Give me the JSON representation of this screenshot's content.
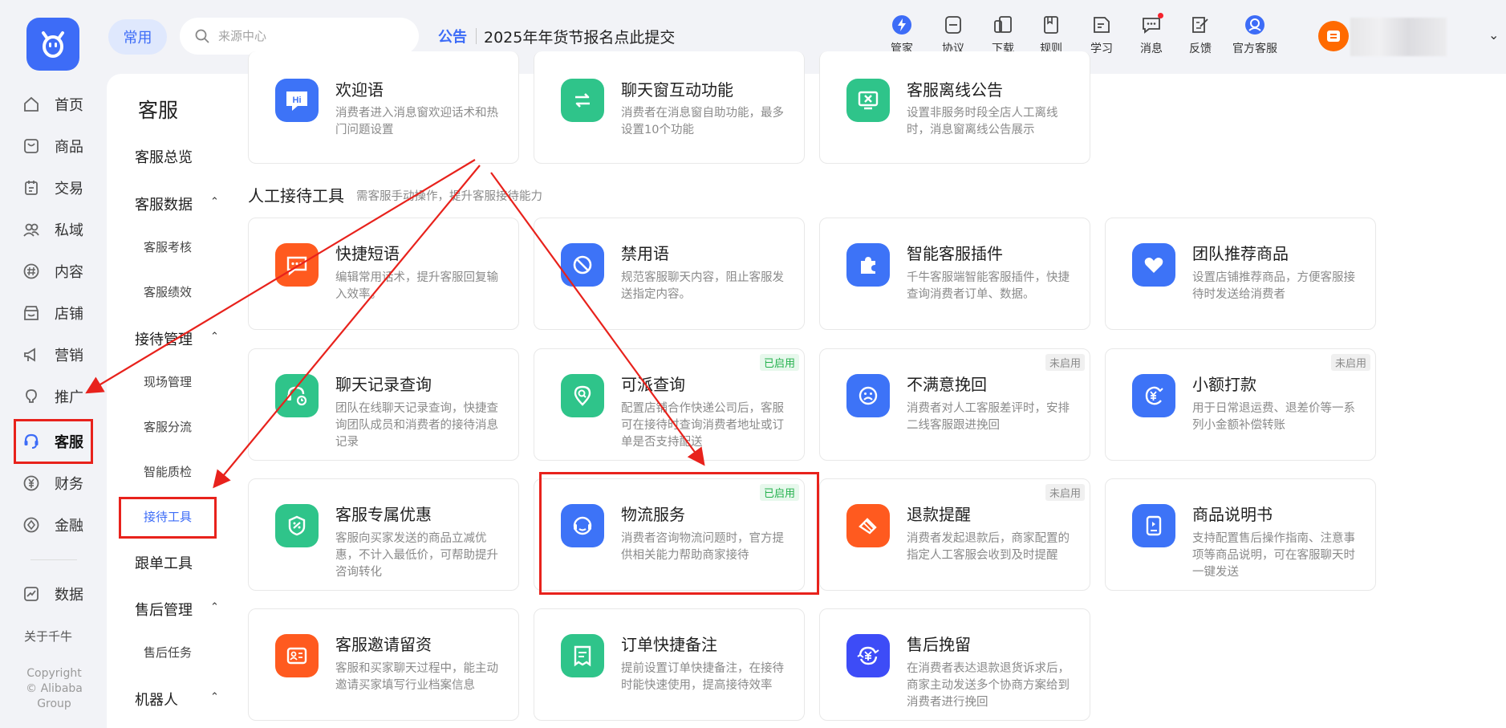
{
  "header": {
    "common_label": "常用",
    "search_placeholder": "来源中心",
    "notice_tag": "公告",
    "notice_text": "2025年年货节报名点此提交",
    "tools": [
      {
        "label": "管家",
        "icon": "lightning-icon"
      },
      {
        "label": "协议",
        "icon": "agreement-icon"
      },
      {
        "label": "下载",
        "icon": "download-icon"
      },
      {
        "label": "规则",
        "icon": "rules-icon"
      },
      {
        "label": "学习",
        "icon": "learn-icon"
      },
      {
        "label": "消息",
        "icon": "message-icon"
      },
      {
        "label": "反馈",
        "icon": "feedback-icon"
      },
      {
        "label": "官方客服",
        "icon": "official-service-icon"
      }
    ]
  },
  "leftnav": {
    "items": [
      {
        "label": "首页",
        "icon": "home-icon"
      },
      {
        "label": "商品",
        "icon": "goods-icon"
      },
      {
        "label": "交易",
        "icon": "trade-icon"
      },
      {
        "label": "私域",
        "icon": "private-domain-icon"
      },
      {
        "label": "内容",
        "icon": "content-icon"
      },
      {
        "label": "店铺",
        "icon": "shop-icon"
      },
      {
        "label": "营销",
        "icon": "marketing-icon"
      },
      {
        "label": "推广",
        "icon": "promotion-icon"
      },
      {
        "label": "客服",
        "icon": "headset-icon"
      },
      {
        "label": "财务",
        "icon": "finance-icon"
      },
      {
        "label": "金融",
        "icon": "fintech-icon"
      },
      {
        "label": "数据",
        "icon": "data-icon"
      }
    ],
    "about": "关于千牛",
    "copyright_line1": "Copyright",
    "copyright_line2": "© Alibaba",
    "copyright_line3": "Group"
  },
  "subnav": {
    "title": "客服",
    "overview": "客服总览",
    "data_group": "客服数据",
    "data_children": [
      "客服考核",
      "客服绩效"
    ],
    "reception_group": "接待管理",
    "reception_children": [
      "现场管理",
      "客服分流",
      "智能质检",
      "接待工具"
    ],
    "followup": "跟单工具",
    "aftersale_group": "售后管理",
    "aftersale_children": [
      "售后任务"
    ],
    "robot_group": "机器人"
  },
  "section": {
    "title": "人工接待工具",
    "subtitle": "需客服手动操作，提升客服接待能力"
  },
  "colors": {
    "accent": "#3d6cf7",
    "green": "#2fc48a",
    "orange": "#ff5a1f",
    "highlight_red": "#e8221c"
  },
  "cards_top": [
    {
      "title": "欢迎语",
      "desc": "消费者进入消息窗欢迎话术和热门问题设置",
      "icon": "hi-icon",
      "color": "#3d73f7"
    },
    {
      "title": "聊天窗互动功能",
      "desc": "消费者在消息窗自助功能，最多设置10个功能",
      "icon": "swap-icon",
      "color": "#2fc48a"
    },
    {
      "title": "客服离线公告",
      "desc": "设置非服务时段全店人工离线时，消息窗离线公告展示",
      "icon": "offline-screen-icon",
      "color": "#2fc48a"
    }
  ],
  "cards": [
    {
      "title": "快捷短语",
      "desc": "编辑常用话术，提升客服回复输入效率。",
      "icon": "quick-phrase-icon",
      "color": "#ff5a1f",
      "badge": ""
    },
    {
      "title": "禁用语",
      "desc": "规范客服聊天内容，阻止客服发送指定内容。",
      "icon": "forbidden-icon",
      "color": "#3d73f7",
      "badge": ""
    },
    {
      "title": "智能客服插件",
      "desc": "千牛客服端智能客服插件，快捷查询消费者订单、数据。",
      "icon": "puzzle-icon",
      "color": "#3d73f7",
      "badge": ""
    },
    {
      "title": "团队推荐商品",
      "desc": "设置店铺推荐商品，方便客服接待时发送给消费者",
      "icon": "heart-icon",
      "color": "#3d73f7",
      "badge": ""
    },
    {
      "title": "聊天记录查询",
      "desc": "团队在线聊天记录查询，快捷查询团队成员和消费者的接待消息记录",
      "icon": "chat-history-icon",
      "color": "#2fc48a",
      "badge": ""
    },
    {
      "title": "可派查询",
      "desc": "配置店铺合作快递公司后，客服可在接待时查询消费者地址或订单是否支持配送",
      "icon": "location-search-icon",
      "color": "#2fc48a",
      "badge": "已启用"
    },
    {
      "title": "不满意挽回",
      "desc": "消费者对人工客服差评时，安排二线客服跟进挽回",
      "icon": "sad-face-icon",
      "color": "#3d73f7",
      "badge": "未启用"
    },
    {
      "title": "小额打款",
      "desc": "用于日常退运费、退差价等一系列小金额补偿转账",
      "icon": "yuan-transfer-icon",
      "color": "#3d73f7",
      "badge": "未启用"
    },
    {
      "title": "客服专属优惠",
      "desc": "客服向买家发送的商品立减优惠，不计入最低价，可帮助提升咨询转化",
      "icon": "coupon-icon",
      "color": "#2fc48a",
      "badge": ""
    },
    {
      "title": "物流服务",
      "desc": "消费者咨询物流问题时，官方提供相关能力帮助商家接待",
      "icon": "headset-icon",
      "color": "#3d73f7",
      "badge": "已启用"
    },
    {
      "title": "退款提醒",
      "desc": "消费者发起退款后，商家配置的指定人工客服会收到及时提醒",
      "icon": "refund-icon",
      "color": "#ff5a1f",
      "badge": "未启用"
    },
    {
      "title": "商品说明书",
      "desc": "支持配置售后操作指南、注意事项等商品说明，可在客服聊天时一键发送",
      "icon": "manual-icon",
      "color": "#3d73f7",
      "badge": ""
    },
    {
      "title": "客服邀请留资",
      "desc": "客服和买家聊天过程中，能主动邀请买家填写行业档案信息",
      "icon": "contact-card-icon",
      "color": "#ff5a1f",
      "badge": ""
    },
    {
      "title": "订单快捷备注",
      "desc": "提前设置订单快捷备注，在接待时能快速使用，提高接待效率",
      "icon": "note-icon",
      "color": "#2fc48a",
      "badge": ""
    },
    {
      "title": "售后挽留",
      "desc": "在消费者表达退款退货诉求后，商家主动发送多个协商方案给到消费者进行挽回",
      "icon": "yuan-retain-icon",
      "color": "#3d4cf7",
      "badge": ""
    }
  ]
}
